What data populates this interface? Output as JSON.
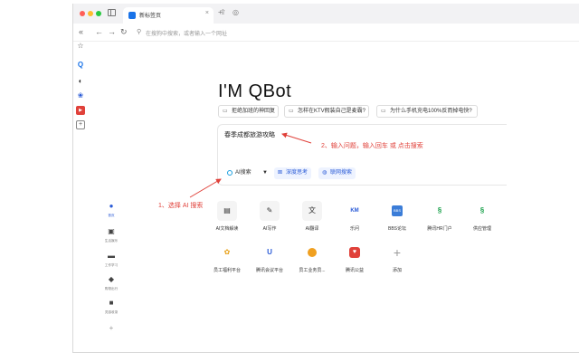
{
  "browser": {
    "tab_title": "新标签页",
    "address_placeholder": "在搜狗中搜索，或者输入一个网址"
  },
  "main": {
    "title": "I'M QBot",
    "suggestions": [
      "拒绝加班的神回复",
      "怎样在KTV假装自己是麦霸?",
      "为什么手机充电100%反而掉电快?"
    ],
    "search": {
      "query": "春季成都旅游攻略",
      "mode_label": "AI搜索",
      "buttons": [
        "深度思考",
        "联网搜索"
      ]
    }
  },
  "annotations": {
    "step1": "1、选择 AI 搜索",
    "step2": "2、输入问题，输入回车 或 点击搜索"
  },
  "left_nav": [
    {
      "label": "首页",
      "icon": "bell-icon"
    },
    {
      "label": "生活娱乐",
      "icon": "image-icon"
    },
    {
      "label": "工作学习",
      "icon": "briefcase-icon"
    },
    {
      "label": "购物出行",
      "icon": "tag-icon"
    },
    {
      "label": "灵感收录",
      "icon": "folder-icon"
    }
  ],
  "apps_row1": [
    {
      "label": "AI文档解读",
      "icon": "file-text-icon"
    },
    {
      "label": "AI写作",
      "icon": "pen-icon"
    },
    {
      "label": "AI翻译",
      "icon": "translate-icon"
    },
    {
      "label": "乐问",
      "icon": "km-icon",
      "text": "KM"
    },
    {
      "label": "BBS论坛",
      "icon": "bbs-icon",
      "text": "BBS"
    },
    {
      "label": "腾讯HR门户",
      "icon": "hr-portal-icon"
    },
    {
      "label": "供应管理",
      "icon": "supply-icon"
    }
  ],
  "apps_row2": [
    {
      "label": "员工福利平台",
      "icon": "welfare-icon"
    },
    {
      "label": "腾讯会议平台",
      "icon": "meeting-icon"
    },
    {
      "label": "员工业务员...",
      "icon": "business-icon"
    },
    {
      "label": "腾讯公益",
      "icon": "charity-icon"
    },
    {
      "label": "添加",
      "icon": "plus-icon",
      "text": "+"
    }
  ],
  "colors": {
    "accent": "#2a5bd7",
    "annotation": "#e0413a"
  }
}
